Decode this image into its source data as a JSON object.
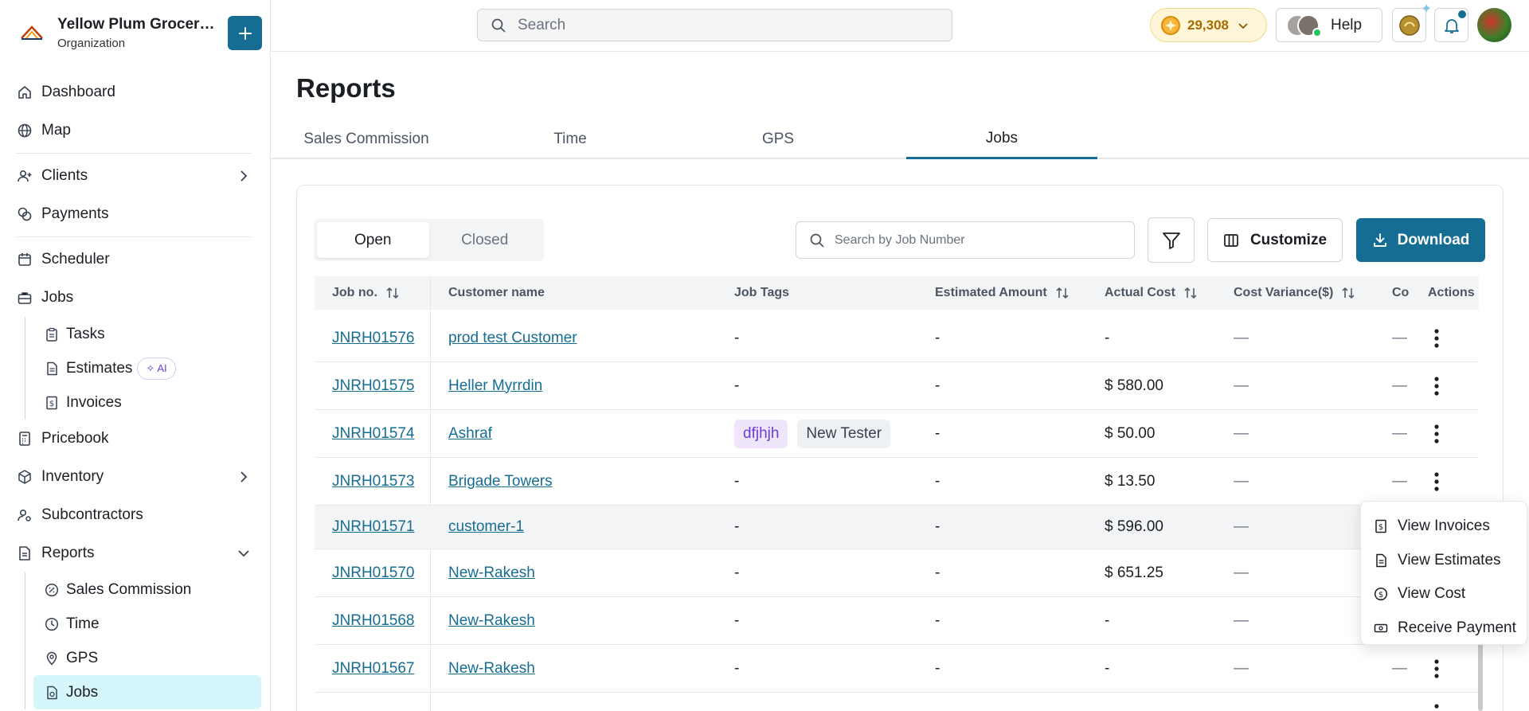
{
  "org": {
    "name": "Yellow Plum Grocers...",
    "subtitle": "Organization"
  },
  "sidebar": {
    "items": [
      {
        "label": "Dashboard"
      },
      {
        "label": "Map"
      },
      {
        "label": "Clients"
      },
      {
        "label": "Payments"
      },
      {
        "label": "Scheduler"
      },
      {
        "label": "Jobs"
      },
      {
        "label": "Tasks"
      },
      {
        "label": "Estimates"
      },
      {
        "label": "Invoices"
      },
      {
        "label": "Pricebook"
      },
      {
        "label": "Inventory"
      },
      {
        "label": "Subcontractors"
      },
      {
        "label": "Reports"
      },
      {
        "label": "Sales Commission"
      },
      {
        "label": "Time"
      },
      {
        "label": "GPS"
      },
      {
        "label": "Jobs"
      }
    ],
    "ai_badge": "AI"
  },
  "topbar": {
    "search_placeholder": "Search",
    "coins": "29,308",
    "help": "Help"
  },
  "page": {
    "title": "Reports",
    "tabs": [
      "Sales Commission",
      "Time",
      "GPS",
      "Jobs"
    ],
    "active_tab": "Jobs"
  },
  "toolbar": {
    "segments": [
      "Open",
      "Closed"
    ],
    "job_search_placeholder": "Search by Job Number",
    "customize": "Customize",
    "download": "Download"
  },
  "table": {
    "headers": [
      "Job no.",
      "Customer name",
      "Job Tags",
      "Estimated Amount",
      "Actual Cost",
      "Cost Variance($)",
      "Co",
      "Actions"
    ],
    "rows": [
      {
        "job": "JNRH01576",
        "customer": "prod test Customer",
        "tags": [],
        "tags_text": "-",
        "estimated": "-",
        "actual": "-",
        "variance": "—",
        "co": "—"
      },
      {
        "job": "JNRH01575",
        "customer": "Heller Myrrdin",
        "tags": [],
        "tags_text": "-",
        "estimated": "-",
        "actual": "$ 580.00",
        "variance": "—",
        "co": "—"
      },
      {
        "job": "JNRH01574",
        "customer": "Ashraf",
        "tags": [
          "dfjhjh",
          "New Tester"
        ],
        "tags_text": "",
        "estimated": "-",
        "actual": "$ 50.00",
        "variance": "—",
        "co": "—"
      },
      {
        "job": "JNRH01573",
        "customer": "Brigade Towers",
        "tags": [],
        "tags_text": "-",
        "estimated": "-",
        "actual": "$ 13.50",
        "variance": "—",
        "co": "—"
      },
      {
        "job": "JNRH01571",
        "customer": "customer-1",
        "tags": [],
        "tags_text": "-",
        "estimated": "-",
        "actual": "$ 596.00",
        "variance": "—",
        "co": ""
      },
      {
        "job": "JNRH01570",
        "customer": "New-Rakesh",
        "tags": [],
        "tags_text": "-",
        "estimated": "-",
        "actual": "$ 651.25",
        "variance": "—",
        "co": ""
      },
      {
        "job": "JNRH01568",
        "customer": "New-Rakesh",
        "tags": [],
        "tags_text": "-",
        "estimated": "-",
        "actual": "-",
        "variance": "—",
        "co": ""
      },
      {
        "job": "JNRH01567",
        "customer": "New-Rakesh",
        "tags": [],
        "tags_text": "-",
        "estimated": "-",
        "actual": "-",
        "variance": "—",
        "co": "—"
      }
    ]
  },
  "actions_menu": [
    "View Invoices",
    "View Estimates",
    "View Cost",
    "Receive Payment"
  ],
  "colors": {
    "primary": "#166d94",
    "active_nav": "#d5f7fb",
    "coin_bg": "#fff6d9",
    "tag_purple": "#6b3fd1"
  }
}
